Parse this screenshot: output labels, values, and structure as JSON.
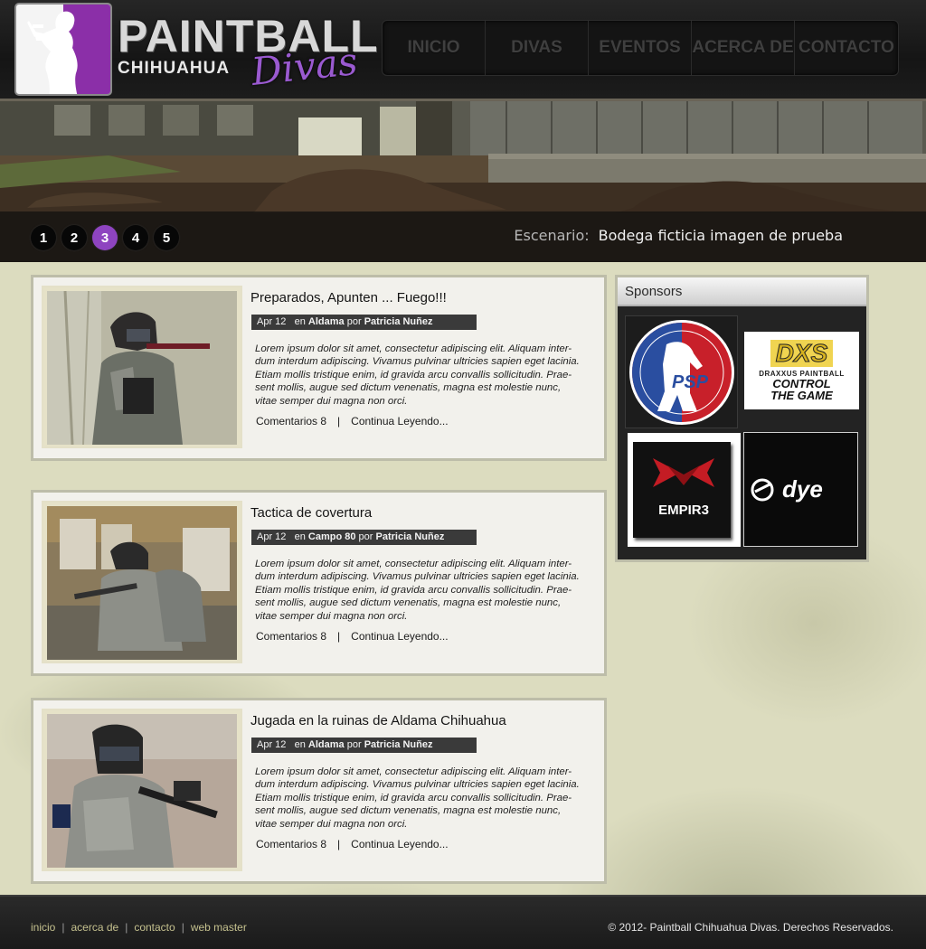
{
  "logo": {
    "main": "PAINTBALL",
    "city": "CHIHUAHUA",
    "script": "Divas"
  },
  "nav": [
    {
      "label": "INICIO",
      "active": true
    },
    {
      "label": "DIVAS",
      "active": false
    },
    {
      "label": "EVENTOS",
      "active": false
    },
    {
      "label": "ACERCA DE",
      "active": false
    },
    {
      "label": "CONTACTO",
      "active": false
    }
  ],
  "slider": {
    "pages": [
      "1",
      "2",
      "3",
      "4",
      "5"
    ],
    "active_page": "3",
    "caption_label": "Escenario:",
    "caption_text": "Bodega ficticia imagen de prueba"
  },
  "posts": [
    {
      "title": "Preparados, Apunten ... Fuego!!!",
      "date": "Apr 12",
      "in_label": "en",
      "category": "Aldama",
      "by_label": "por",
      "author": "Patricia Nuñez",
      "lines": [
        "Lorem ipsum dolor sit amet, consectetur adipiscing elit. Aliquam inter-",
        "dum interdum adipiscing. Vivamus pulvinar ultricies sapien eget lacinia.",
        "Etiam mollis tristique enim, id gravida arcu convallis sollicitudin. Prae-",
        "sent mollis, augue sed dictum venenatis, magna est molestie nunc,",
        "vitae semper dui magna non orci."
      ],
      "comments": "Comentarios 8",
      "separator": "|",
      "read_more": "Continua Leyendo..."
    },
    {
      "title": "Tactica de covertura",
      "date": "Apr 12",
      "in_label": "en",
      "category": "Campo 80",
      "by_label": "por",
      "author": "Patricia Nuñez",
      "lines": [
        "Lorem ipsum dolor sit amet, consectetur adipiscing elit. Aliquam inter-",
        "dum interdum adipiscing. Vivamus pulvinar ultricies sapien eget lacinia.",
        "Etiam mollis tristique enim, id gravida arcu convallis sollicitudin. Prae-",
        "sent mollis, augue sed dictum venenatis, magna est molestie nunc,",
        "vitae semper dui magna non orci."
      ],
      "comments": "Comentarios 8",
      "separator": "|",
      "read_more": "Continua Leyendo..."
    },
    {
      "title": "Jugada en la ruinas de Aldama Chihuahua",
      "date": "Apr 12",
      "in_label": "en",
      "category": "Aldama",
      "by_label": "por",
      "author": "Patricia Nuñez",
      "lines": [
        "Lorem ipsum dolor sit amet, consectetur adipiscing elit. Aliquam inter-",
        "dum interdum adipiscing. Vivamus pulvinar ultricies sapien eget lacinia.",
        "Etiam mollis tristique enim, id gravida arcu convallis sollicitudin. Prae-",
        "sent mollis, augue sed dictum venenatis, magna est molestie nunc,",
        "vitae semper dui magna non orci."
      ],
      "comments": "Comentarios 8",
      "separator": "|",
      "read_more": "Continua Leyendo..."
    }
  ],
  "sponsors": {
    "title": "Sponsors",
    "items": [
      {
        "name": "PSP",
        "logo_text": "PSP",
        "ring_text": "PAINTBALL SPORTS PROMOTIONS"
      },
      {
        "name": "Draxxus",
        "logo_text": "DXS",
        "line1": "DRAXXUS PAINTBALL",
        "line2": "CONTROL",
        "line3": "THE GAME"
      },
      {
        "name": "Empire",
        "logo_text": "EMPIR3"
      },
      {
        "name": "Dye",
        "logo_text": "dye"
      }
    ]
  },
  "footer": {
    "links": [
      "inicio",
      "acerca de",
      "contacto",
      "web master"
    ],
    "separator": "|",
    "copyright": "© 2012- Paintball Chihuahua Divas. Derechos Reservados."
  },
  "colors": {
    "accent_purple": "#8e44c0",
    "nav_active": "#cfc790",
    "footer_link": "#c4c08e"
  }
}
